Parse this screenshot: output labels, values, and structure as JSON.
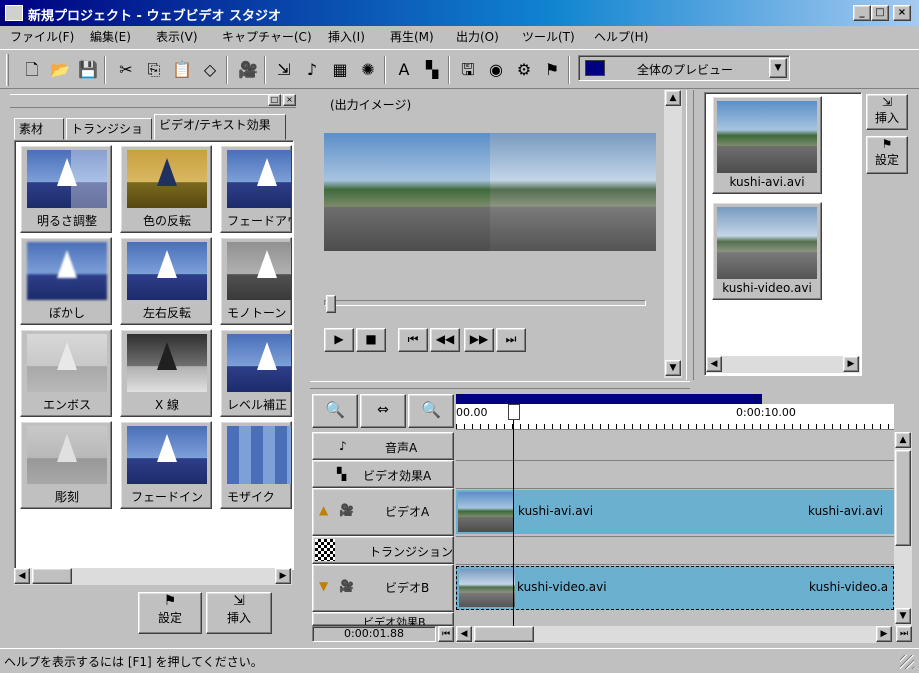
{
  "window": {
    "title": "新規プロジェクト - ウェブビデオ スタジオ",
    "controls": [
      "_",
      "□",
      "×"
    ]
  },
  "menu": [
    "ファイル(F)",
    "編集(E)",
    "表示(V)",
    "キャプチャー(C)",
    "挿入(I)",
    "再生(M)",
    "出力(O)",
    "ツール(T)",
    "ヘルプ(H)"
  ],
  "toolbar": {
    "preview_label": "全体のプレビュー",
    "dropdown_arrow": "▼"
  },
  "left_panel": {
    "tabs": [
      "素材",
      "トランジション",
      "ビデオ/テキスト効果"
    ],
    "effects": [
      "明るさ調整",
      "色の反転",
      "フェードアウ",
      "ぼかし",
      "左右反転",
      "モノトーン",
      "エンボス",
      "X 線",
      "レベル補正",
      "彫刻",
      "フェードイン",
      "モザイク"
    ],
    "buttons": {
      "settings": "設定",
      "insert": "挿入"
    }
  },
  "preview": {
    "title": "(出力イメージ)"
  },
  "clips": {
    "items": [
      "kushi-avi.avi",
      "kushi-video.avi"
    ],
    "insert": "挿入",
    "settings": "設定"
  },
  "timeline": {
    "ruler_start": "00.00",
    "ruler_mark": "0:00:10.00",
    "current_time": "0:00:01.88",
    "tracks": [
      "音声A",
      "ビデオ効果A",
      "ビデオA",
      "トランジション",
      "ビデオB",
      "ビデオ効果B"
    ],
    "clip_a": {
      "left": "kushi-avi.avi",
      "right": "kushi-avi.avi"
    },
    "clip_b": {
      "left": "kushi-video.avi",
      "right": "kushi-video.a"
    }
  },
  "status": "ヘルプを表示するには [F1] を押してください。"
}
